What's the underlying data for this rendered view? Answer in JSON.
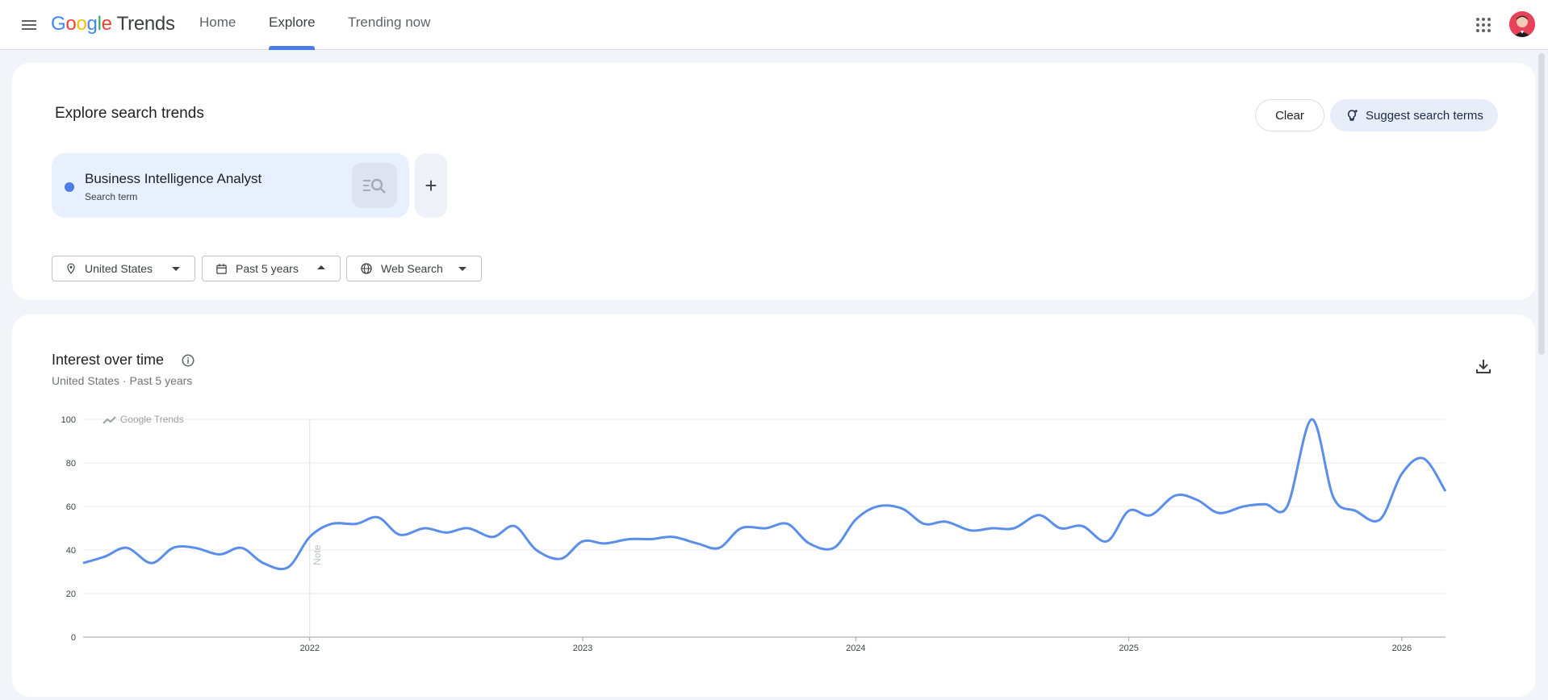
{
  "app": {
    "logo_google": [
      "G",
      "o",
      "o",
      "g",
      "l",
      "e"
    ],
    "logo_trends": "Trends",
    "nav": [
      {
        "label": "Home",
        "active": false
      },
      {
        "label": "Explore",
        "active": true
      },
      {
        "label": "Trending now",
        "active": false
      }
    ],
    "icons": {
      "menu": "hamburger-icon",
      "apps": "grid-icon",
      "avatar": "user-avatar"
    }
  },
  "explore": {
    "title": "Explore search trends",
    "clear_label": "Clear",
    "suggest_label": "Suggest search terms",
    "term": {
      "name": "Business Intelligence Analyst",
      "type": "Search term",
      "color": "#4a7ee6"
    },
    "add_label": "+",
    "filters": {
      "location": "United States",
      "time": "Past 5 years",
      "property": "Web Search"
    }
  },
  "interest": {
    "title": "Interest over time",
    "subtitle": "United States · Past 5 years",
    "watermark": "Google Trends",
    "note_label": "Note"
  },
  "chart_data": {
    "type": "line",
    "ylim": [
      0,
      100
    ],
    "yticks": [
      0,
      20,
      40,
      60,
      80,
      100
    ],
    "xticks": [
      {
        "label": "2022",
        "x": 2022.0
      },
      {
        "label": "2023",
        "x": 2023.0
      },
      {
        "label": "2024",
        "x": 2024.0
      },
      {
        "label": "2025",
        "x": 2025.0
      },
      {
        "label": "2026",
        "x": 2026.0
      }
    ],
    "xlim": [
      2021.17,
      2026.16
    ],
    "grid": true,
    "note_at": 2022.0,
    "series": [
      {
        "color": "#5a8ee8",
        "points": [
          [
            2021.17,
            34
          ],
          [
            2021.25,
            37
          ],
          [
            2021.33,
            41
          ],
          [
            2021.42,
            34
          ],
          [
            2021.5,
            41
          ],
          [
            2021.58,
            41
          ],
          [
            2021.67,
            38
          ],
          [
            2021.75,
            41
          ],
          [
            2021.83,
            34
          ],
          [
            2021.92,
            32
          ],
          [
            2022.0,
            46
          ],
          [
            2022.08,
            52
          ],
          [
            2022.17,
            52
          ],
          [
            2022.25,
            55
          ],
          [
            2022.33,
            47
          ],
          [
            2022.42,
            50
          ],
          [
            2022.5,
            48
          ],
          [
            2022.58,
            50
          ],
          [
            2022.67,
            46
          ],
          [
            2022.75,
            51
          ],
          [
            2022.83,
            40
          ],
          [
            2022.92,
            36
          ],
          [
            2023.0,
            44
          ],
          [
            2023.08,
            43
          ],
          [
            2023.17,
            45
          ],
          [
            2023.25,
            45
          ],
          [
            2023.33,
            46
          ],
          [
            2023.42,
            43
          ],
          [
            2023.5,
            41
          ],
          [
            2023.58,
            50
          ],
          [
            2023.67,
            50
          ],
          [
            2023.75,
            52
          ],
          [
            2023.83,
            43
          ],
          [
            2023.92,
            41
          ],
          [
            2024.0,
            54
          ],
          [
            2024.08,
            60
          ],
          [
            2024.17,
            59
          ],
          [
            2024.25,
            52
          ],
          [
            2024.33,
            53
          ],
          [
            2024.42,
            49
          ],
          [
            2024.5,
            50
          ],
          [
            2024.58,
            50
          ],
          [
            2024.67,
            56
          ],
          [
            2024.75,
            50
          ],
          [
            2024.83,
            51
          ],
          [
            2024.92,
            44
          ],
          [
            2025.0,
            58
          ],
          [
            2025.08,
            56
          ],
          [
            2025.17,
            65
          ],
          [
            2025.25,
            63
          ],
          [
            2025.33,
            57
          ],
          [
            2025.42,
            60
          ],
          [
            2025.5,
            61
          ],
          [
            2025.58,
            60
          ],
          [
            2025.67,
            100
          ],
          [
            2025.75,
            64
          ],
          [
            2025.83,
            58
          ],
          [
            2025.92,
            54
          ],
          [
            2026.0,
            75
          ],
          [
            2026.08,
            82
          ],
          [
            2026.16,
            67
          ]
        ]
      }
    ]
  }
}
